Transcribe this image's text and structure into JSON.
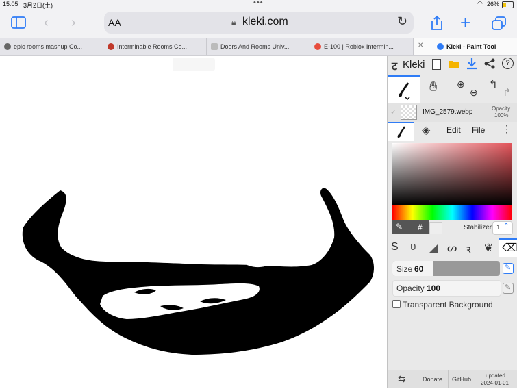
{
  "status": {
    "time": "15:05",
    "date": "3月2日(土)",
    "battery": "26%"
  },
  "toolbar": {
    "text_size": "AA",
    "url": "kleki.com"
  },
  "tabs": [
    {
      "label": "epic rooms mashup Co..."
    },
    {
      "label": "Interminable Rooms Co..."
    },
    {
      "label": "Doors And Rooms Univ..."
    },
    {
      "label": "E-100 | Roblox Intermin..."
    },
    {
      "label": "Kleki - Paint Tool"
    }
  ],
  "app": {
    "logo": "Kleki",
    "layer": {
      "name": "IMG_2579.webp",
      "opacity_label": "Opacity",
      "opacity_value": "100%"
    },
    "subtabs": {
      "edit": "Edit",
      "file": "File"
    },
    "color_hex_symbol": "#",
    "stabilizer": {
      "label": "Stabilizer",
      "value": "1"
    },
    "size": {
      "label": "Size",
      "value": "60"
    },
    "opacity": {
      "label": "Opacity",
      "value": "100"
    },
    "transparent_bg": "Transparent Background",
    "footer": {
      "donate": "Donate",
      "github": "GitHub",
      "updated_label": "updated",
      "updated_date": "2024-01-01"
    }
  },
  "colors": {
    "accent": "#2f7cf6",
    "selected_color": "#e4545a"
  }
}
